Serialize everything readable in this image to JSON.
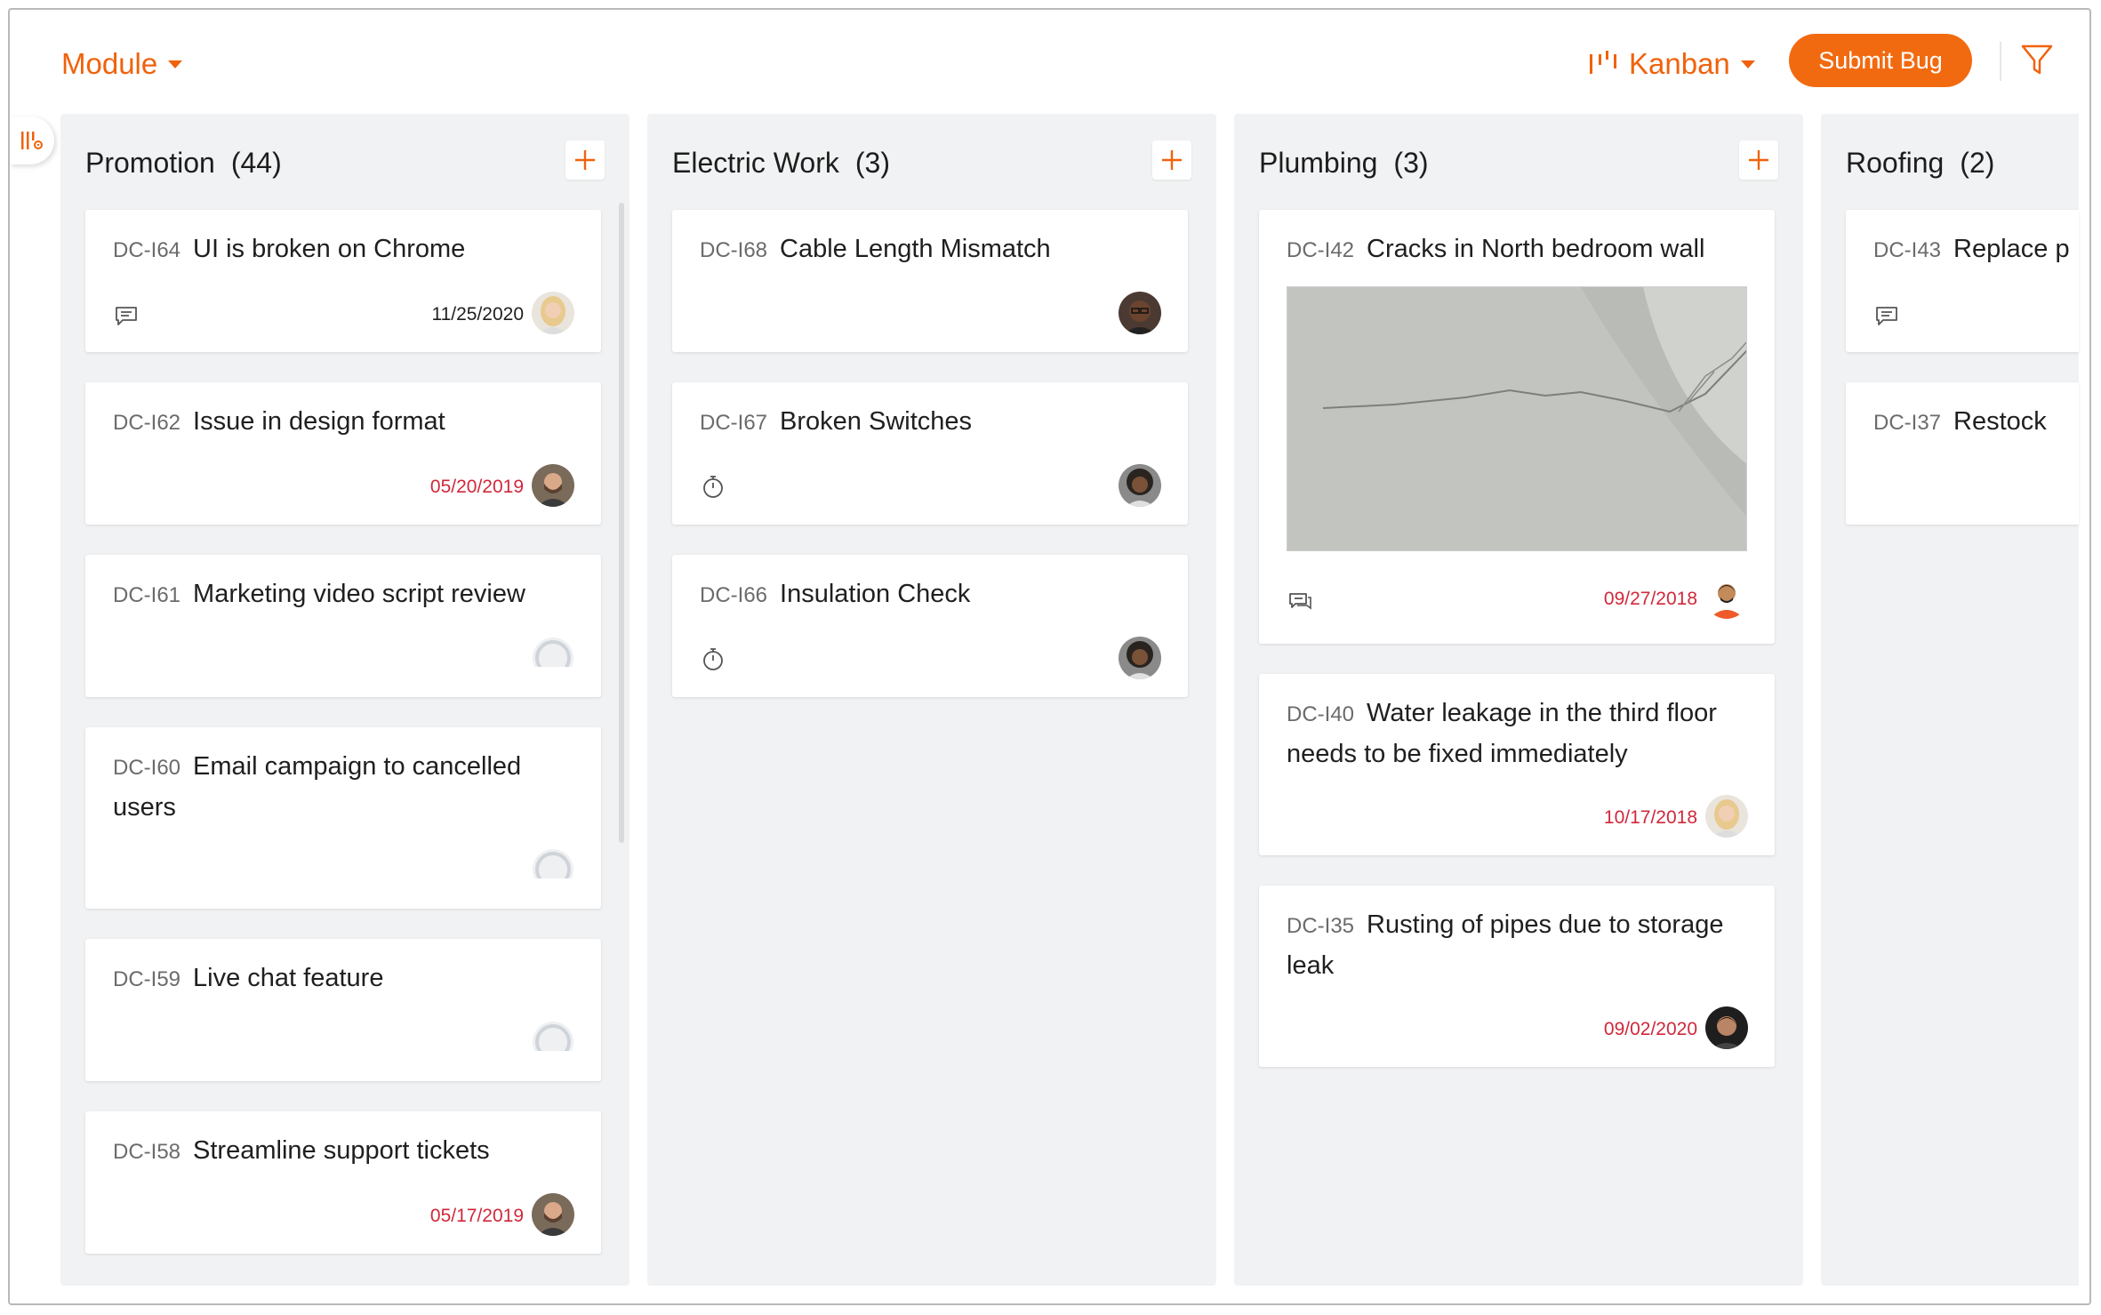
{
  "header": {
    "module_label": "Module",
    "view_label": "Kanban",
    "submit_label": "Submit Bug"
  },
  "colors": {
    "accent": "#f26a10",
    "overdue": "#d0283a",
    "column_bg": "#f1f2f3"
  },
  "columns": [
    {
      "title": "Promotion",
      "count": "(44)",
      "cards": [
        {
          "id": "DC-I64",
          "title": "UI is broken on Chrome",
          "date": "11/25/2020",
          "overdue": false,
          "icon": "comment-icon",
          "avatar": "woman-blonde"
        },
        {
          "id": "DC-I62",
          "title": "Issue in design format",
          "date": "05/20/2019",
          "overdue": true,
          "icon": "",
          "avatar": "man-beard"
        },
        {
          "id": "DC-I61",
          "title": "Marketing video script review",
          "date": "",
          "overdue": false,
          "icon": "",
          "avatar": "placeholder"
        },
        {
          "id": "DC-I60",
          "title": "Email campaign to cancelled users",
          "date": "",
          "overdue": false,
          "icon": "",
          "avatar": "placeholder"
        },
        {
          "id": "DC-I59",
          "title": "Live chat feature",
          "date": "",
          "overdue": false,
          "icon": "",
          "avatar": "placeholder"
        },
        {
          "id": "DC-I58",
          "title": "Streamline support tickets",
          "date": "05/17/2019",
          "overdue": true,
          "icon": "",
          "avatar": "man-beard"
        }
      ]
    },
    {
      "title": "Electric Work",
      "count": "(3)",
      "cards": [
        {
          "id": "DC-I68",
          "title": "Cable Length Mismatch",
          "date": "",
          "overdue": false,
          "icon": "",
          "avatar": "man-glasses"
        },
        {
          "id": "DC-I67",
          "title": "Broken Switches",
          "date": "",
          "overdue": false,
          "icon": "timer-icon",
          "avatar": "woman-curly"
        },
        {
          "id": "DC-I66",
          "title": "Insulation Check",
          "date": "",
          "overdue": false,
          "icon": "timer-icon",
          "avatar": "woman-curly"
        }
      ]
    },
    {
      "title": "Plumbing",
      "count": "(3)",
      "cards": [
        {
          "id": "DC-I42",
          "title": "Cracks in North bedroom wall",
          "date": "09/27/2018",
          "overdue": true,
          "icon": "comments-icon",
          "avatar": "man-orange",
          "image": "wall-crack-photo"
        },
        {
          "id": "DC-I40",
          "title": "Water leakage in the third floor needs to be fixed immediately",
          "date": "10/17/2018",
          "overdue": true,
          "icon": "",
          "avatar": "woman-blonde"
        },
        {
          "id": "DC-I35",
          "title": "Rusting of pipes due to storage leak",
          "date": "09/02/2020",
          "overdue": true,
          "icon": "",
          "avatar": "man-dark"
        }
      ]
    },
    {
      "title": "Roofing",
      "count": "(2)",
      "cards": [
        {
          "id": "DC-I43",
          "title": "Replace p",
          "date": "",
          "overdue": false,
          "icon": "comment-icon",
          "avatar": ""
        },
        {
          "id": "DC-I37",
          "title": "Restock",
          "date": "",
          "overdue": false,
          "icon": "",
          "avatar": ""
        }
      ]
    }
  ]
}
